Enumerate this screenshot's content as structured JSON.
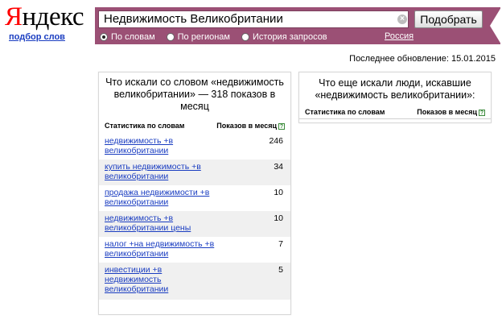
{
  "logo": {
    "first_letter": "Я",
    "rest": "ндекс"
  },
  "service_link": "подбор слов",
  "search": {
    "query": "Недвижимость Великобритании",
    "clear_icon": "close-icon",
    "submit_label": "Подобрать",
    "radios": [
      {
        "label": "По словам",
        "checked": true
      },
      {
        "label": "По регионам",
        "checked": false
      },
      {
        "label": "История запросов",
        "checked": false
      }
    ],
    "region": "Россия",
    "bar_color": "#9b5075"
  },
  "last_update": "Последнее обновление: 15.01.2015",
  "left_panel": {
    "title": "Что искали со словом «недвижимость великобритании» — 318 показов в месяц",
    "col_keywords": "Статистика по словам",
    "col_shows": "Показов в месяц",
    "help_icon": "?",
    "rows": [
      {
        "keyword": "недвижимость +в великобритании",
        "count": "246"
      },
      {
        "keyword": "купить недвижимость +в великобритании",
        "count": "34"
      },
      {
        "keyword": "продажа недвижимости +в великобритании",
        "count": "10"
      },
      {
        "keyword": "недвижимость +в великобритании цены",
        "count": "10"
      },
      {
        "keyword": "налог +на недвижимость +в великобритании",
        "count": "7"
      },
      {
        "keyword": "инвестиции +в недвижимость великобритании",
        "count": "5"
      }
    ]
  },
  "right_panel": {
    "title": "Что еще искали люди, искавшие «недвижимость великобритании»:",
    "col_keywords": "Статистика по словам",
    "col_shows": "Показов в месяц",
    "help_icon": "?"
  },
  "colors": {
    "link": "#1a3dc1",
    "logo_accent": "#ff0000",
    "help": "#3a8a3a"
  }
}
